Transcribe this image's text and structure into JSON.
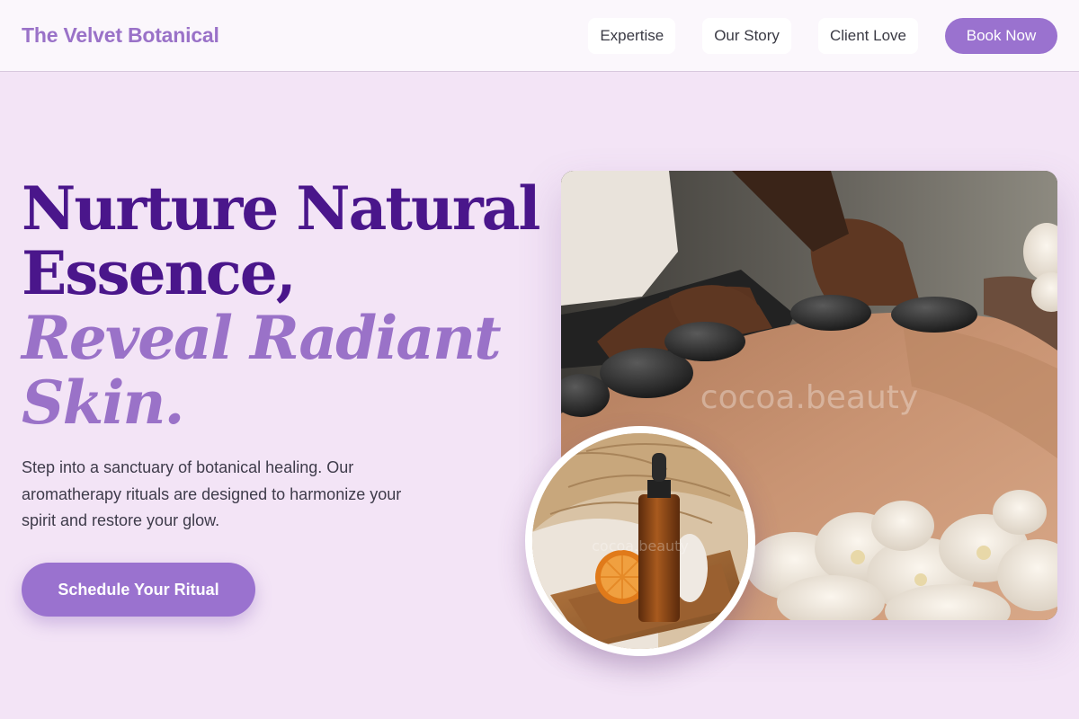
{
  "header": {
    "brand": "The Velvet Botanical",
    "nav": [
      {
        "label": "Expertise"
      },
      {
        "label": "Our Story"
      },
      {
        "label": "Client Love"
      }
    ],
    "book_label": "Book Now"
  },
  "hero": {
    "title_line1": "Nurture Natural",
    "title_line2": "Essence,",
    "title_line3": "Reveal Radiant",
    "title_line4": "Skin.",
    "description": "Step into a sanctuary of botanical healing. Our aromatherapy rituals are designed to harmonize your spirit and restore your glow.",
    "cta_label": "Schedule Your Ritual"
  },
  "images": {
    "main_watermark": "cocoa.beauty",
    "circle_watermark": "cocoa.beauty"
  },
  "colors": {
    "background": "#f3e4f6",
    "accent": "#9a72cf",
    "title_dark": "#4a168b",
    "title_light": "#9a72c8"
  }
}
